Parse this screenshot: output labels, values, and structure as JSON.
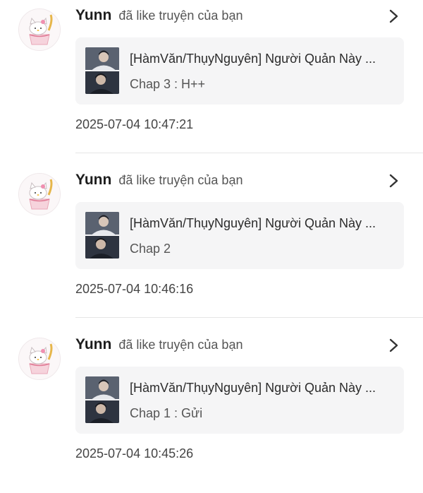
{
  "notifications": [
    {
      "user": "Yunn",
      "action": "đã like truyện của bạn",
      "story_title": "[HàmVăn/ThụyNguyên] Người Quản Này ...",
      "chapter": "Chap 3 : H++",
      "timestamp": "2025-07-04 10:47:21",
      "avatar_icon": "hello-kitty-cake-icon",
      "chevron_icon": "chevron-right-icon"
    },
    {
      "user": "Yunn",
      "action": "đã like truyện của bạn",
      "story_title": "[HàmVăn/ThụyNguyên] Người Quản Này ...",
      "chapter": "Chap 2",
      "timestamp": "2025-07-04 10:46:16",
      "avatar_icon": "hello-kitty-cake-icon",
      "chevron_icon": "chevron-right-icon"
    },
    {
      "user": "Yunn",
      "action": "đã like truyện của bạn",
      "story_title": "[HàmVăn/ThụyNguyên] Người Quản Này ...",
      "chapter": "Chap 1 : Gửi",
      "timestamp": "2025-07-04 10:45:26",
      "avatar_icon": "hello-kitty-cake-icon",
      "chevron_icon": "chevron-right-icon"
    }
  ],
  "colors": {
    "card_background": "#f5f5f6",
    "divider": "#e6e6e6",
    "username": "#1d1d1d"
  }
}
